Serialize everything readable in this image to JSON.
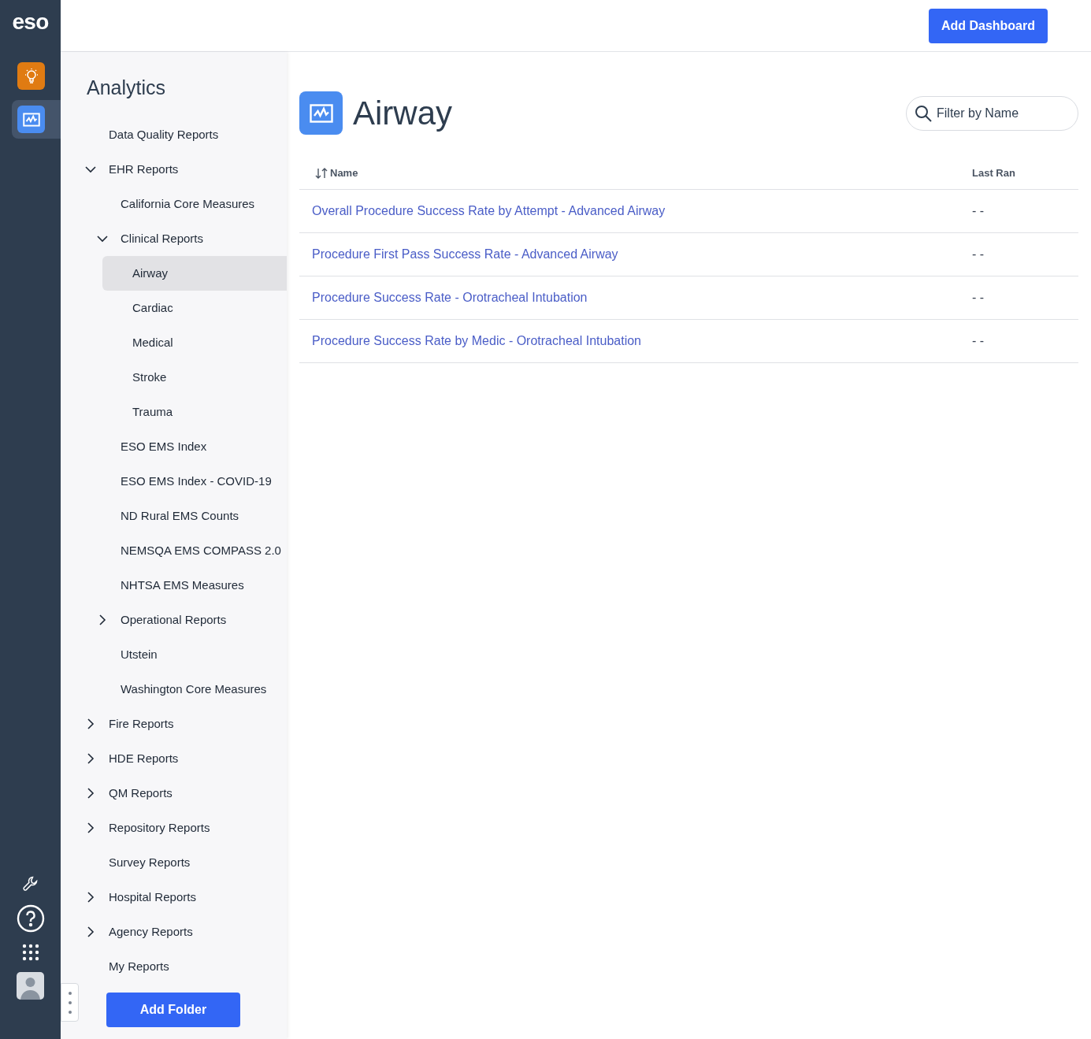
{
  "rail": {
    "logo": "eso",
    "apps": [
      {
        "kind": "insights",
        "selected": false
      },
      {
        "kind": "analytics",
        "selected": true
      }
    ],
    "tools": [
      {
        "kind": "wrench"
      },
      {
        "kind": "help"
      },
      {
        "kind": "apps"
      },
      {
        "kind": "avatar"
      }
    ]
  },
  "header": {
    "add_dashboard": "Add Dashboard"
  },
  "sidebar": {
    "title": "Analytics",
    "items": [
      {
        "label": "Data Quality Reports",
        "selected": false
      },
      {
        "label": "EHR Reports",
        "selected": false,
        "expanded": true,
        "children": [
          {
            "label": "California Core Measures",
            "selected": false
          },
          {
            "label": "Clinical Reports",
            "selected": false,
            "expanded": true,
            "children": [
              {
                "label": "Airway",
                "selected": true
              },
              {
                "label": "Cardiac",
                "selected": false
              },
              {
                "label": "Medical",
                "selected": false
              },
              {
                "label": "Stroke",
                "selected": false
              },
              {
                "label": "Trauma",
                "selected": false
              }
            ]
          },
          {
            "label": "ESO EMS Index",
            "selected": false
          },
          {
            "label": "ESO EMS Index - COVID-19",
            "selected": false
          },
          {
            "label": "ND Rural EMS Counts",
            "selected": false
          },
          {
            "label": "NEMSQA EMS COMPASS 2.0",
            "selected": false
          },
          {
            "label": "NHTSA EMS Measures",
            "selected": false
          },
          {
            "label": "Operational Reports",
            "selected": false,
            "expanded": false
          },
          {
            "label": "Utstein",
            "selected": false
          },
          {
            "label": "Washington Core Measures",
            "selected": false
          }
        ]
      },
      {
        "label": "Fire Reports",
        "selected": false,
        "expanded": false
      },
      {
        "label": "HDE Reports",
        "selected": false,
        "expanded": false
      },
      {
        "label": "QM Reports",
        "selected": false,
        "expanded": false
      },
      {
        "label": "Repository Reports",
        "selected": false,
        "expanded": false
      },
      {
        "label": "Survey Reports",
        "selected": false
      },
      {
        "label": "Hospital Reports",
        "selected": false,
        "expanded": false
      },
      {
        "label": "Agency Reports",
        "selected": false,
        "expanded": false
      },
      {
        "label": "My Reports",
        "selected": false
      }
    ],
    "add_folder": "Add Folder"
  },
  "main": {
    "title": "Airway",
    "filter": {
      "placeholder": "Filter by Name"
    },
    "table": {
      "columns": [
        "Name",
        "Last Ran"
      ],
      "rows": [
        [
          "Overall Procedure Success Rate by Attempt - Advanced Airway",
          "- -"
        ],
        [
          "Procedure First Pass Success Rate - Advanced Airway",
          "- -"
        ],
        [
          "Procedure Success Rate - Orotracheal Intubation",
          "- -"
        ],
        [
          "Procedure Success Rate by Medic - Orotracheal Intubation",
          "- -"
        ]
      ]
    }
  }
}
